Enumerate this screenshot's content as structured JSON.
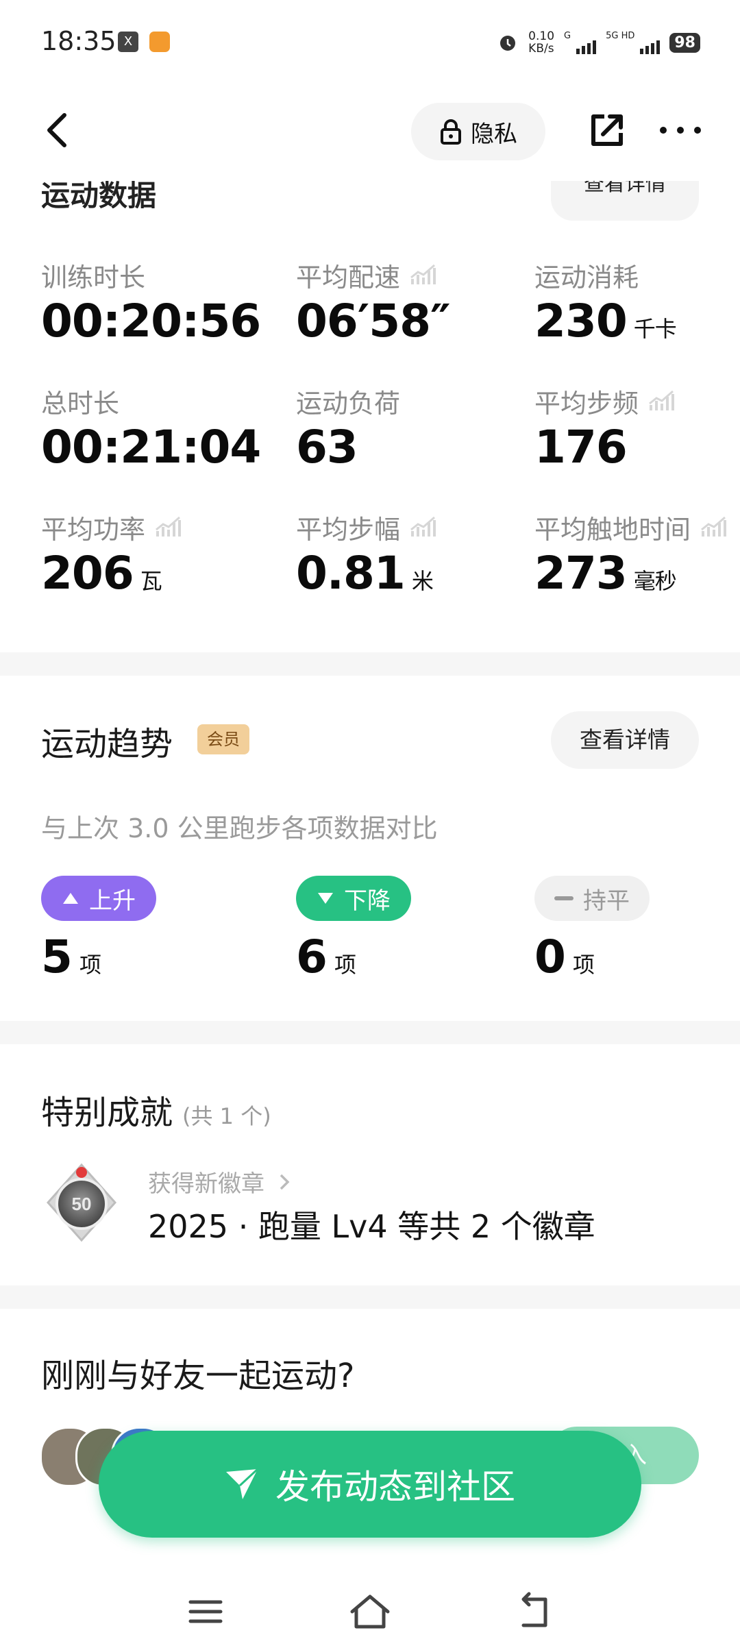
{
  "status_bar": {
    "time": "18:35",
    "app_icon_1": "X",
    "net_speed_value": "0.10",
    "net_speed_unit": "KB/s",
    "signal_1_label": "G",
    "signal_2_label": "5G HD",
    "battery": "98"
  },
  "header": {
    "privacy_label": "隐私",
    "icons": [
      "back-icon",
      "lock-icon",
      "share-icon",
      "more-icon"
    ]
  },
  "stats_section": {
    "title": "运动数据",
    "detail_label": "查看详情",
    "items": [
      {
        "label": "训练时长",
        "value": "00:20:56",
        "unit": ""
      },
      {
        "label": "平均配速",
        "value": "06′58″",
        "unit": ""
      },
      {
        "label": "运动消耗",
        "value": "230",
        "unit": "千卡"
      },
      {
        "label": "总时长",
        "value": "00:21:04",
        "unit": ""
      },
      {
        "label": "运动负荷",
        "value": "63",
        "unit": ""
      },
      {
        "label": "平均步频",
        "value": "176",
        "unit": ""
      },
      {
        "label": "平均功率",
        "value": "206",
        "unit": "瓦"
      },
      {
        "label": "平均步幅",
        "value": "0.81",
        "unit": "米"
      },
      {
        "label": "平均触地时间",
        "value": "273",
        "unit": "毫秒"
      }
    ]
  },
  "trend_section": {
    "title": "运动趋势",
    "member_tag": "会员",
    "detail_label": "查看详情",
    "subtitle": "与上次 3.0 公里跑步各项数据对比",
    "up_label": "上升",
    "up_count": "5",
    "down_label": "下降",
    "down_count": "6",
    "flat_label": "持平",
    "flat_count": "0",
    "count_unit": "项",
    "colors": {
      "up": "#8f6cf0",
      "down": "#27c183",
      "flat": "#f0f0f0"
    }
  },
  "achievement_section": {
    "title": "特别成就",
    "count_label": "(共 1 个)",
    "medal_number": "50",
    "new_badge_label": "获得新徽章",
    "badge_text": "2025 · 跑量 Lv4 等共 2 个徽章"
  },
  "friends_section": {
    "title": "刚刚与好友一起运动?",
    "join_label": "加入"
  },
  "publish_button": {
    "label": "发布动态到社区",
    "color": "#27c183"
  },
  "nav_bar": {
    "icons": [
      "menu-icon",
      "home-icon",
      "back-nav-icon"
    ]
  }
}
